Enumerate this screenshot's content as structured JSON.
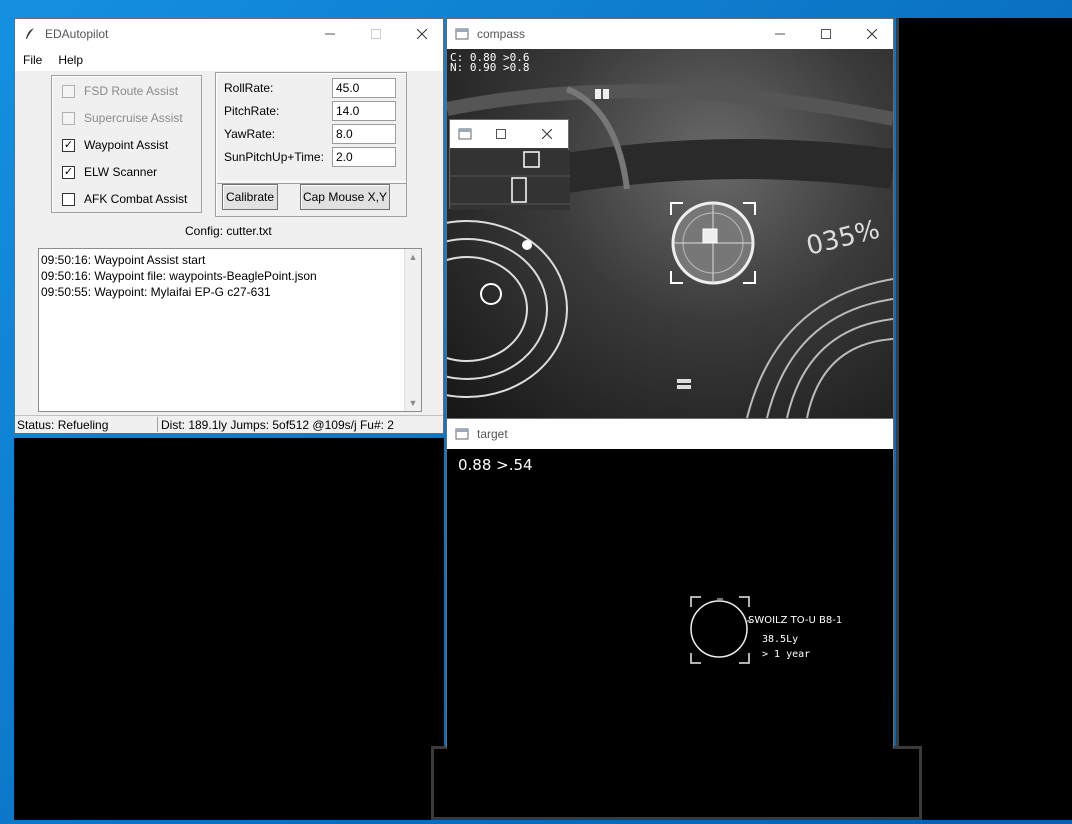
{
  "colors": {
    "desktop": "#0f7ed0",
    "window_bg": "#f0f0f0",
    "titlebar": "#ffffff"
  },
  "autopilot": {
    "title": "EDAutopilot",
    "menu": [
      "File",
      "Help"
    ],
    "assists": [
      {
        "label": "FSD Route Assist",
        "checked": false,
        "enabled": false
      },
      {
        "label": "Supercruise Assist",
        "checked": false,
        "enabled": false
      },
      {
        "label": "Waypoint Assist",
        "checked": true,
        "enabled": true
      },
      {
        "label": "ELW Scanner",
        "checked": true,
        "enabled": true
      },
      {
        "label": "AFK Combat Assist",
        "checked": false,
        "enabled": true
      }
    ],
    "rates": [
      {
        "label": "RollRate:",
        "value": "45.0"
      },
      {
        "label": "PitchRate:",
        "value": "14.0"
      },
      {
        "label": "YawRate:",
        "value": "8.0"
      },
      {
        "label": "SunPitchUp+Time:",
        "value": "2.0"
      }
    ],
    "calibrate_label": "Calibrate",
    "cap_mouse_label": "Cap Mouse X,Y",
    "config": "Config: cutter.txt",
    "log": [
      "09:50:16: Waypoint Assist start",
      "09:50:16: Waypoint file: waypoints-BeaglePoint.json",
      "09:50:55: Waypoint: Mylaifai EP-G c27-631"
    ],
    "status": "Status: Refueling",
    "route_info": "Dist: 189.1ly  Jumps: 5of512  @109s/j  Fu#: 2"
  },
  "compass": {
    "title": "compass",
    "line1": "C: 0.80 >0.6",
    "line2": "N: 0.90 >0.8",
    "hud_percent": "035%"
  },
  "target": {
    "title": "target",
    "score": "0.88 >.54",
    "system_name": "SWOILZ TO-U B8-1",
    "distance": "38.5Ly",
    "age": "> 1 year"
  }
}
